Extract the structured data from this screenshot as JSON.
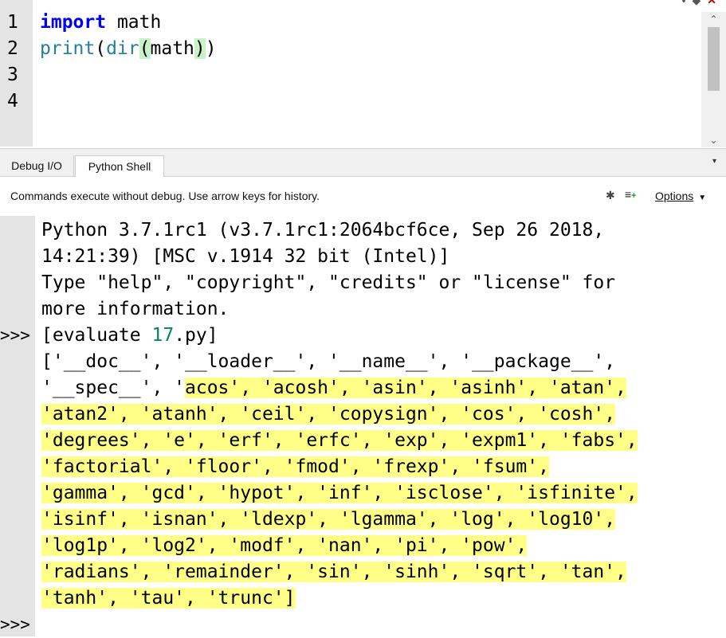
{
  "editor": {
    "line_numbers": [
      "1",
      "2",
      "3",
      "4"
    ],
    "line1": {
      "keyword": "import",
      "rest": " math"
    },
    "line2": {
      "print": "print",
      "p1": "(",
      "dir": "dir",
      "p2": "(",
      "arg": "math",
      "p3": ")",
      "p4": ")"
    }
  },
  "tabs": {
    "debug": "Debug I/O",
    "shell": "Python Shell"
  },
  "info": {
    "text": "Commands execute without debug.  Use arrow keys for history.",
    "options_label": "Options"
  },
  "shell": {
    "prompt": ">>>",
    "header_lines": [
      "Python 3.7.1rc1 (v3.7.1rc1:2064bcf6ce, Sep 26 2018,",
      "14:21:39) [MSC v.1914 32 bit (Intel)]",
      "Type \"help\", \"copyright\", \"credits\" or \"license\" for",
      "more information."
    ],
    "evaluate": {
      "prefix": "[evaluate ",
      "number": "17",
      "suffix": ".py]"
    },
    "output_first": "['__doc__', '__loader__', '__name__', '__package__',",
    "output_second_plain": "'__spec__', '",
    "output_second_hl": "acos', 'acosh', 'asin', 'asinh', 'atan',",
    "output_hl_lines": [
      "'atan2', 'atanh', 'ceil', 'copysign', 'cos', 'cosh',",
      "'degrees', 'e', 'erf', 'erfc', 'exp', 'expm1', 'fabs',",
      "'factorial', 'floor', 'fmod', 'frexp', 'fsum',",
      "'gamma', 'gcd', 'hypot', 'inf', 'isclose', 'isfinite',",
      "'isinf', 'isnan', 'ldexp', 'lgamma', 'log', 'log10',",
      "'log1p', 'log2', 'modf', 'nan', 'pi', 'pow',",
      "'radians', 'remainder', 'sin', 'sinh', 'sqrt', 'tan',",
      "'tanh', 'tau', 'trunc']"
    ]
  },
  "colors": {
    "keyword": "#0000ff",
    "builtin": "#267f99",
    "highlight": "#ffff88",
    "gutter": "#e4e4e4"
  }
}
